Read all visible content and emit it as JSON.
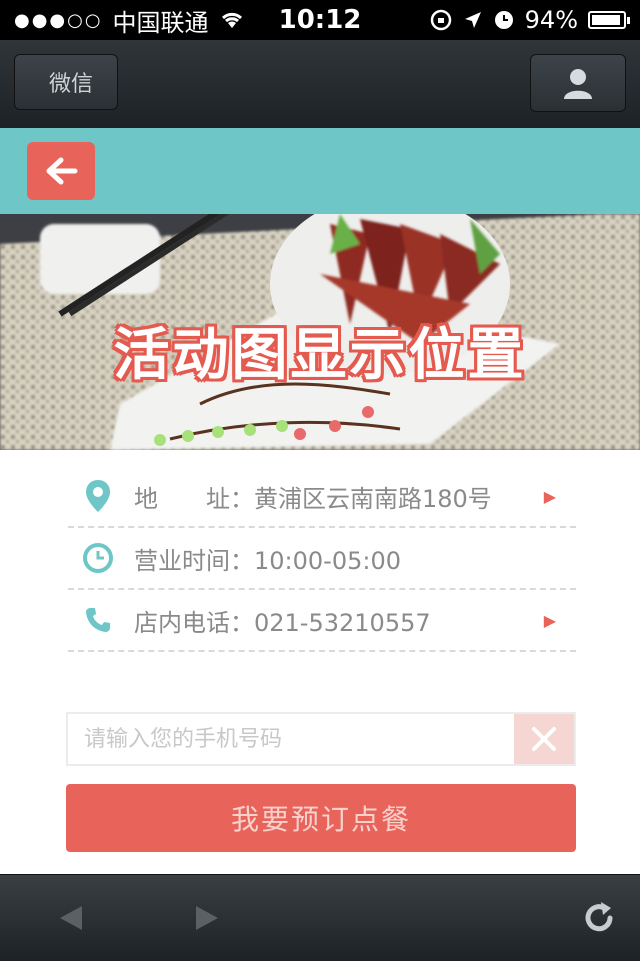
{
  "status_bar": {
    "carrier": "中国联通",
    "time": "10:12",
    "battery": "94%",
    "battery_level": 0.94
  },
  "nav": {
    "back_label": "微信"
  },
  "banner": {
    "caption": "活动图显示位置"
  },
  "info": {
    "address": "地　　址：黄浦区云南南路180号",
    "hours": "营业时间：10:00-05:00",
    "phone": "店内电话：021-53210557"
  },
  "form": {
    "phone_placeholder": "请输入您的手机号码",
    "phone_value": "",
    "order_label": "我要预订点餐"
  },
  "colors": {
    "teal": "#6ec6c6",
    "accent": "#e8645a",
    "nav": "#252b2f"
  },
  "icons": {
    "back": "arrow-left-icon",
    "location": "location-pin-icon",
    "clock": "clock-icon",
    "phone": "phone-icon",
    "clear": "close-icon",
    "refresh": "refresh-icon"
  }
}
